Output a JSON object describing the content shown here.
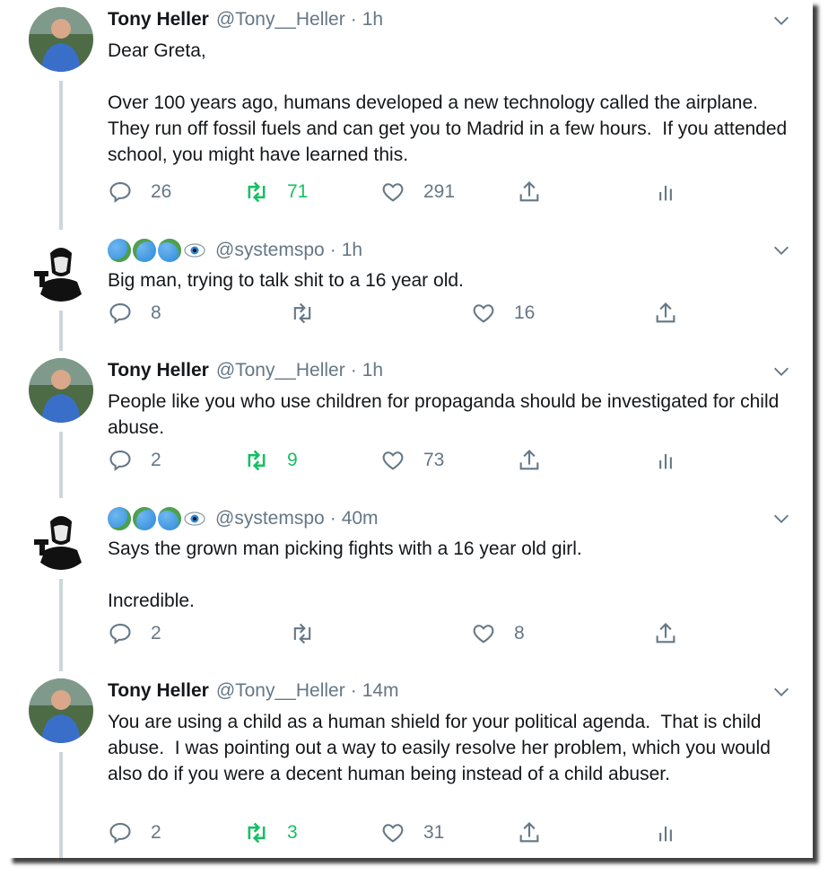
{
  "tweets": [
    {
      "author_name": "Tony Heller",
      "handle": "@Tony__Heller",
      "separator": "·",
      "time": "1h",
      "text": "Dear Greta,\n\nOver 100 years ago, humans developed a new technology called the airplane.  They run off fossil fuels and can get you to Madrid in a few hours.  If you attended school, you might have learned this.",
      "replies": "26",
      "retweets": "71",
      "likes": "291"
    },
    {
      "author_name": "",
      "handle": "@systemspo",
      "separator": "·",
      "time": "1h",
      "text": "Big man, trying to talk shit to a 16 year old.",
      "replies": "8",
      "retweets": "",
      "likes": "16"
    },
    {
      "author_name": "Tony Heller",
      "handle": "@Tony__Heller",
      "separator": "·",
      "time": "1h",
      "text": "People like you who use children for propaganda should be investigated for child abuse.",
      "replies": "2",
      "retweets": "9",
      "likes": "73"
    },
    {
      "author_name": "",
      "handle": "@systemspo",
      "separator": "·",
      "time": "40m",
      "text": "Says the grown man picking fights with a 16 year old girl.\n\nIncredible.",
      "replies": "2",
      "retweets": "",
      "likes": "8"
    },
    {
      "author_name": "Tony Heller",
      "handle": "@Tony__Heller",
      "separator": "·",
      "time": "14m",
      "text": "You are using a child as a human shield for your political agenda.  That is child abuse.  I was pointing out a way to easily resolve her problem, which you would also do if you were a decent human being instead of a child abuser.",
      "replies": "2",
      "retweets": "3",
      "likes": "31"
    }
  ],
  "colors": {
    "text": "#14171a",
    "secondary": "#657786",
    "retweet_active": "#17bf63",
    "thread_line": "#ccd6dd"
  },
  "icons": {
    "reply": "reply-icon",
    "retweet": "retweet-icon",
    "like": "heart-icon",
    "share": "share-icon",
    "analytics": "analytics-icon",
    "menu": "chevron-down-icon",
    "name_emoji": [
      "globe-icon",
      "globe-icon",
      "globe-icon",
      "eye-icon"
    ]
  }
}
